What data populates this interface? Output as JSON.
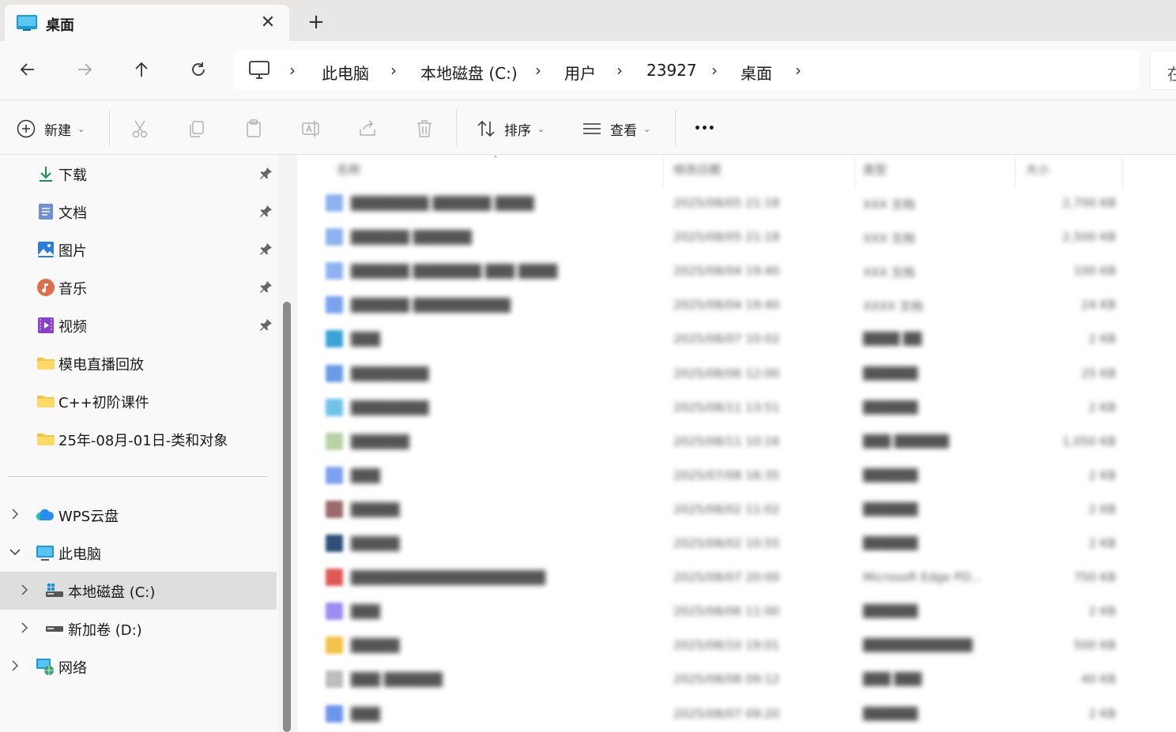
{
  "tab": {
    "title": "桌面",
    "close_glyph": "✕",
    "new_tab_glyph": "+"
  },
  "nav": {
    "back": "arrow-left-icon",
    "forward": "arrow-right-icon",
    "up": "arrow-up-icon",
    "refresh": "refresh-icon"
  },
  "breadcrumb": {
    "items": [
      "此电脑",
      "本地磁盘 (C:)",
      "用户",
      "23927",
      "桌面"
    ],
    "separator": "›",
    "search_stub": "在"
  },
  "commands": {
    "new_label": "新建",
    "sort_label": "排序",
    "view_label": "查看",
    "more_glyph": "•••"
  },
  "sidebar": {
    "quick_access": [
      {
        "label": "下载",
        "icon": "download-icon",
        "pinned": true
      },
      {
        "label": "文档",
        "icon": "document-icon",
        "pinned": true
      },
      {
        "label": "图片",
        "icon": "pictures-icon",
        "pinned": true
      },
      {
        "label": "音乐",
        "icon": "music-icon",
        "pinned": true
      },
      {
        "label": "视频",
        "icon": "video-icon",
        "pinned": true
      },
      {
        "label": "模电直播回放",
        "icon": "folder-icon",
        "pinned": false
      },
      {
        "label": "C++初阶课件",
        "icon": "folder-icon",
        "pinned": false
      },
      {
        "label": "25年-08月-01日-类和对象",
        "icon": "folder-icon",
        "pinned": false
      }
    ],
    "tree": [
      {
        "label": "WPS云盘",
        "icon": "cloud-icon",
        "state": "collapsed"
      },
      {
        "label": "此电脑",
        "icon": "computer-icon",
        "state": "expanded"
      },
      {
        "label": "本地磁盘 (C:)",
        "icon": "drive-c-icon",
        "state": "collapsed",
        "selected": true
      },
      {
        "label": "新加卷 (D:)",
        "icon": "drive-d-icon",
        "state": "collapsed"
      },
      {
        "label": "网络",
        "icon": "network-icon",
        "state": "collapsed"
      }
    ]
  },
  "file_list": {
    "headers": [
      "名称",
      "修改日期",
      "类型",
      "大小"
    ],
    "rows": [
      {
        "name": "████████ ██████ ████",
        "date": "2025/08/05 21:18",
        "type": "XXX 文档",
        "size": "2,700 KB",
        "color": "#8fb3f0"
      },
      {
        "name": "██████ ██████",
        "date": "2025/08/05 21:18",
        "type": "XXX 文档",
        "size": "2,500 KB",
        "color": "#8fb3f0"
      },
      {
        "name": "██████ ███████ ███ ████",
        "date": "2025/08/04 19:40",
        "type": "XXX 文档",
        "size": "100 KB",
        "color": "#8fb3f0"
      },
      {
        "name": "██████ ██████████",
        "date": "2025/08/04 19:40",
        "type": "XXXX 文档",
        "size": "24 KB",
        "color": "#7aa3ee"
      },
      {
        "name": "███",
        "date": "2025/08/07 10:02",
        "type": "████ ██",
        "size": "2 KB",
        "color": "#3aa2d6"
      },
      {
        "name": "████████",
        "date": "2025/08/06 12:00",
        "type": "██████",
        "size": "25 KB",
        "color": "#6a9be8"
      },
      {
        "name": "████████",
        "date": "2025/08/11 13:51",
        "type": "██████",
        "size": "2 KB",
        "color": "#6fc2e8"
      },
      {
        "name": "██████",
        "date": "2025/08/11 10:16",
        "type": "███ ██████",
        "size": "1,050 KB",
        "color": "#b7d3a6"
      },
      {
        "name": "███",
        "date": "2025/07/08 16:35",
        "type": "██████",
        "size": "2 KB",
        "color": "#7ea0f2"
      },
      {
        "name": "█████",
        "date": "2025/08/02 11:02",
        "type": "██████",
        "size": "2 KB",
        "color": "#9a6a6a"
      },
      {
        "name": "█████",
        "date": "2025/08/02 10:55",
        "type": "██████",
        "size": "2 KB",
        "color": "#2f4f7a"
      },
      {
        "name": "████████████████████",
        "date": "2025/08/07 20:00",
        "type": "Microsoft Edge PD...",
        "size": "750 KB",
        "color": "#e05757"
      },
      {
        "name": "███",
        "date": "2025/08/06 11:00",
        "type": "██████",
        "size": "2 KB",
        "color": "#9b8cf0"
      },
      {
        "name": "█████",
        "date": "2025/08/10 19:01",
        "type": "████████████",
        "size": "500 KB",
        "color": "#f3c24a"
      },
      {
        "name": "███ ██████",
        "date": "2025/08/08 09:12",
        "type": "███ ███",
        "size": "40 KB",
        "color": "#bdbdbd"
      },
      {
        "name": "███",
        "date": "2025/08/07 09:20",
        "type": "██████",
        "size": "2 KB",
        "color": "#6e95ee"
      }
    ]
  }
}
